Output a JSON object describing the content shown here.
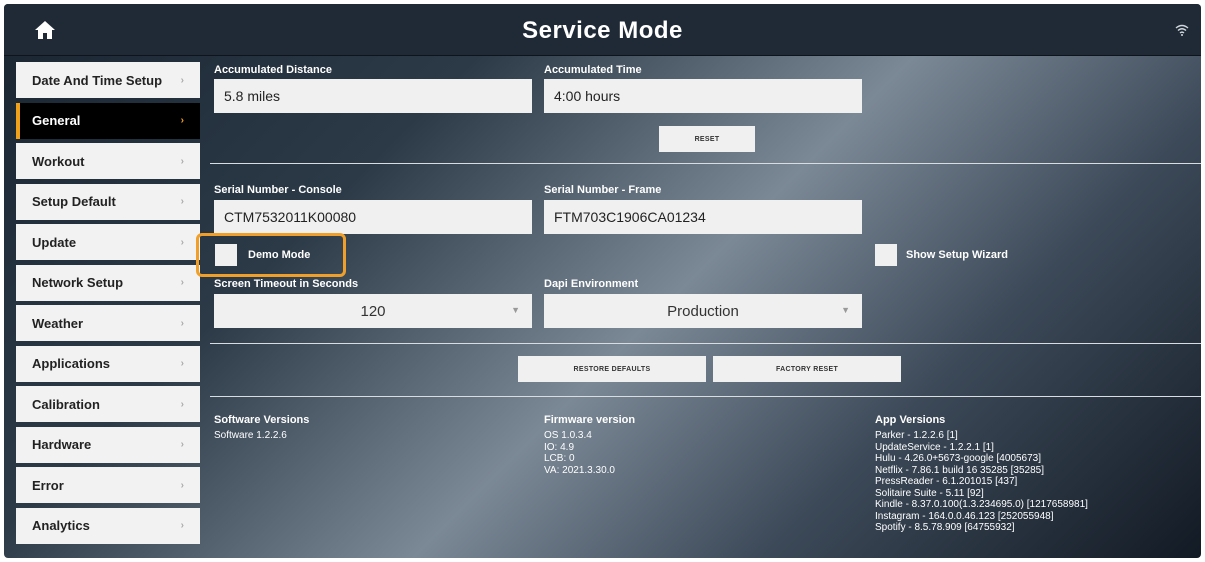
{
  "header": {
    "title": "Service Mode",
    "home_icon": "home-icon",
    "status_icon": "wifi-icon"
  },
  "sidebar": {
    "items": [
      {
        "label": "Date And Time Setup"
      },
      {
        "label": "General",
        "active": true
      },
      {
        "label": "Workout"
      },
      {
        "label": "Setup Default"
      },
      {
        "label": "Update"
      },
      {
        "label": "Network Setup"
      },
      {
        "label": "Weather"
      },
      {
        "label": "Applications"
      },
      {
        "label": "Calibration"
      },
      {
        "label": "Hardware"
      },
      {
        "label": "Error"
      },
      {
        "label": "Analytics"
      }
    ],
    "chevron": "›"
  },
  "general": {
    "accumulated_distance": {
      "label": "Accumulated Distance",
      "value": "5.8 miles"
    },
    "accumulated_time": {
      "label": "Accumulated Time",
      "value": "4:00 hours"
    },
    "reset_label": "RESET",
    "serial_console": {
      "label": "Serial Number - Console",
      "value": "CTM7532011K00080"
    },
    "serial_frame": {
      "label": "Serial Number - Frame",
      "value": "FTM703C1906CA01234"
    },
    "demo_mode": {
      "label": "Demo Mode",
      "checked": false
    },
    "show_setup_wizard": {
      "label": "Show Setup Wizard",
      "checked": false
    },
    "screen_timeout": {
      "label": "Screen Timeout in Seconds",
      "value": "120"
    },
    "dapi_environment": {
      "label": "Dapi Environment",
      "value": "Production"
    },
    "restore_defaults_label": "RESTORE DEFAULTS",
    "factory_reset_label": "FACTORY RESET",
    "software_versions": {
      "title": "Software Versions",
      "lines": [
        "Software 1.2.2.6"
      ]
    },
    "firmware_version": {
      "title": "Firmware version",
      "lines": [
        "OS 1.0.3.4",
        "IO: 4.9",
        "LCB: 0",
        "VA: 2021.3.30.0"
      ]
    },
    "app_versions": {
      "title": "App Versions",
      "lines": [
        "Parker - 1.2.2.6 [1]",
        "UpdateService - 1.2.2.1 [1]",
        "Hulu - 4.26.0+5673-google [4005673]",
        "Netflix - 7.86.1 build 16 35285 [35285]",
        "PressReader - 6.1.201015 [437]",
        "Solitaire Suite - 5.11 [92]",
        "Kindle - 8.37.0.100(1.3.234695.0) [1217658981]",
        "Instagram - 164.0.0.46.123 [252055948]",
        "Spotify - 8.5.78.909 [64755932]"
      ]
    }
  },
  "colors": {
    "accent": "#f0a11b",
    "highlight": "#f0a02a",
    "topbar": "#1f2a36"
  }
}
